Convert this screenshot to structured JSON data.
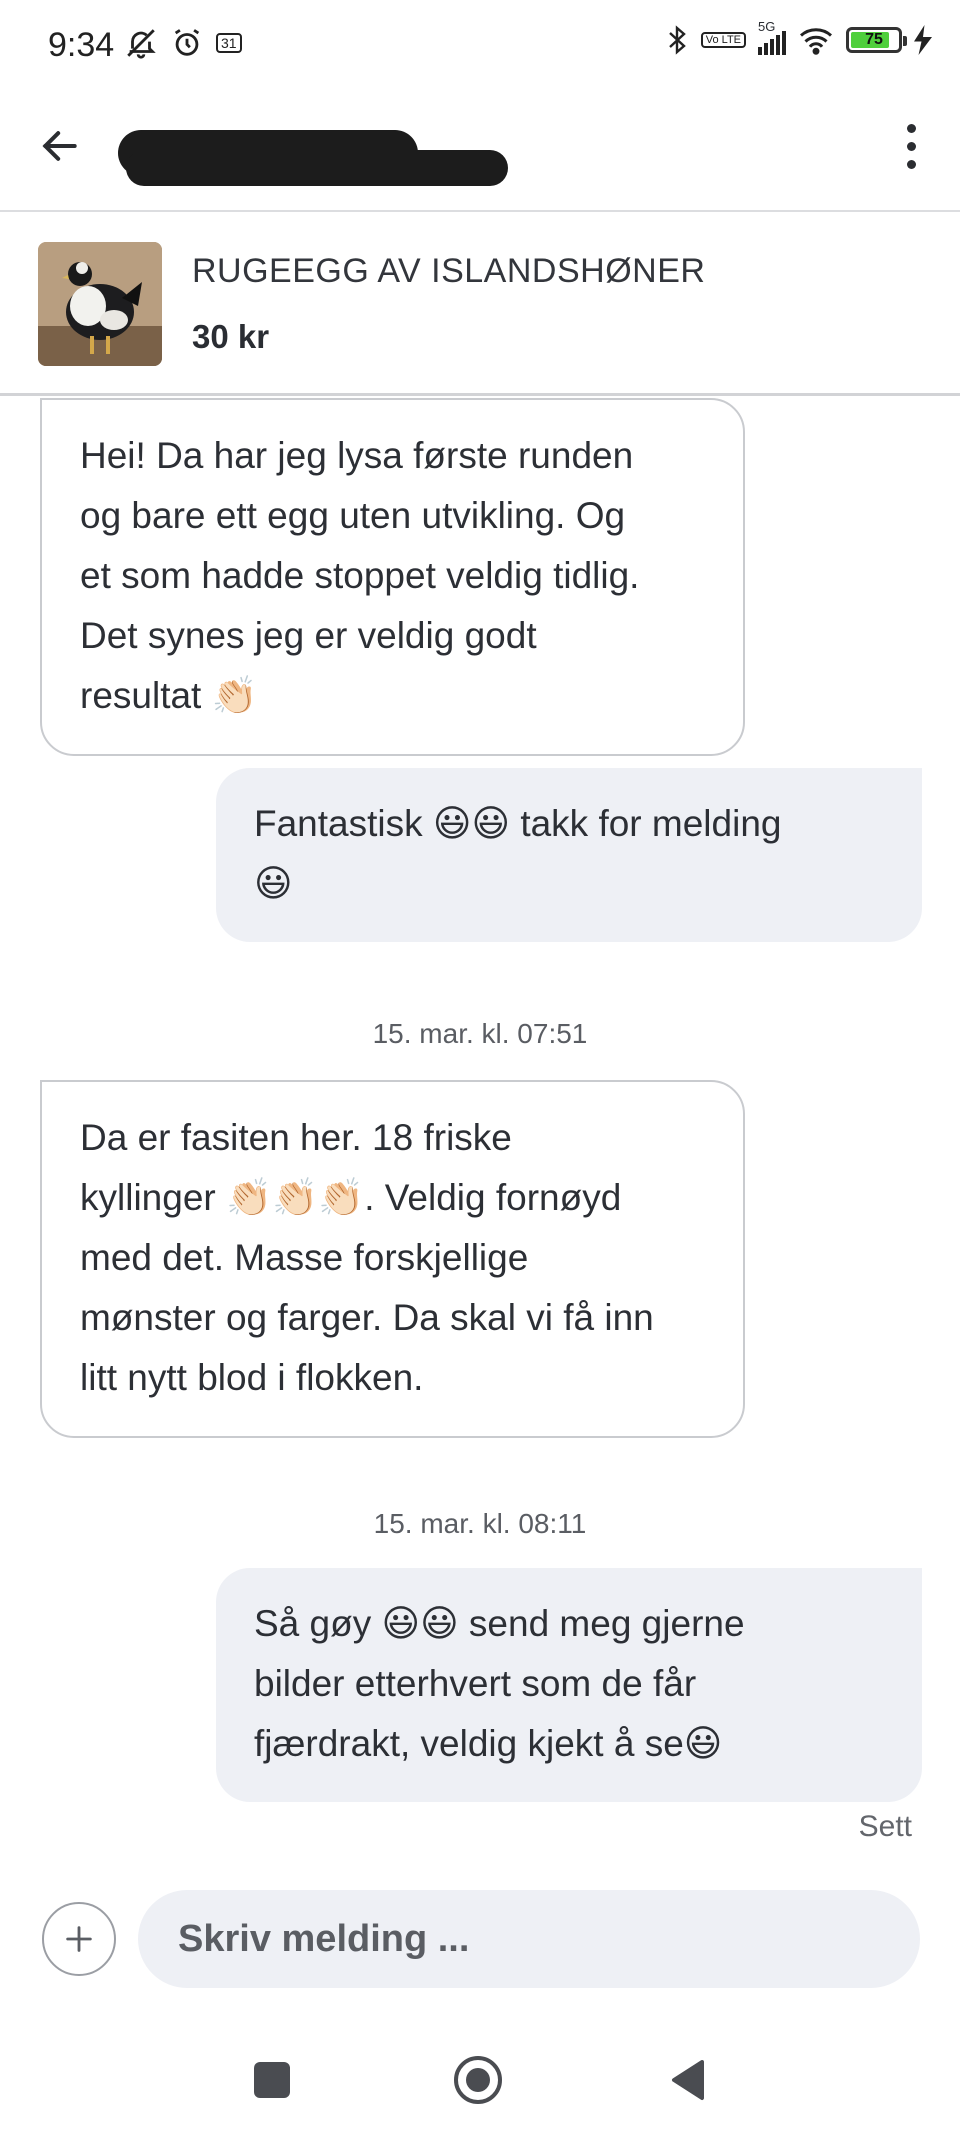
{
  "status_bar": {
    "time": "9:34",
    "calendar_day": "31",
    "network": "5G",
    "volte": "Vo LTE",
    "battery_percent": "75",
    "icons": [
      "bell-off-icon",
      "alarm-icon",
      "calendar-icon",
      "bluetooth-icon",
      "volte-icon",
      "signal-icon",
      "wifi-icon",
      "battery-icon",
      "charging-icon"
    ]
  },
  "app_bar": {
    "back_icon": "arrow-left-icon",
    "more_icon": "more-vertical-icon"
  },
  "listing": {
    "title": "RUGEEGG AV ISLANDSHØNER",
    "price": "30 kr"
  },
  "messages": [
    {
      "direction": "in",
      "lines": [
        "Hei! Da har jeg lysa første runden",
        "og bare ett egg uten utvikling. Og",
        "et som hadde stoppet veldig tidlig.",
        "Det synes jeg er veldig godt",
        "resultat 👏🏻"
      ]
    },
    {
      "direction": "out",
      "lines": [
        "Fantastisk 😃😃 takk for melding",
        "😃"
      ]
    },
    {
      "timestamp": "15. mar. kl. 07:51"
    },
    {
      "direction": "in",
      "lines": [
        "Da er fasiten her. 18 friske",
        "kyllinger 👏🏻👏🏻👏🏻. Veldig fornøyd",
        "med det. Masse forskjellige",
        "mønster og farger. Da skal vi få inn",
        "litt nytt blod i flokken."
      ]
    },
    {
      "timestamp": "15. mar. kl. 08:11"
    },
    {
      "direction": "out",
      "lines": [
        "Så gøy 😃😃 send meg gjerne",
        "bilder etterhvert som de får",
        "fjærdrakt, veldig kjekt å se😃"
      ]
    }
  ],
  "seen_label": "Sett",
  "composer": {
    "placeholder": "Skriv melding ...",
    "value": "",
    "add_icon": "plus-icon"
  },
  "nav_bar": {
    "icons": [
      "recents-icon",
      "home-icon",
      "back-icon"
    ]
  },
  "colors": {
    "outgoing_bubble": "#eef0f5",
    "incoming_border": "#c9cbcf",
    "battery_fill": "#4fcf3c"
  }
}
